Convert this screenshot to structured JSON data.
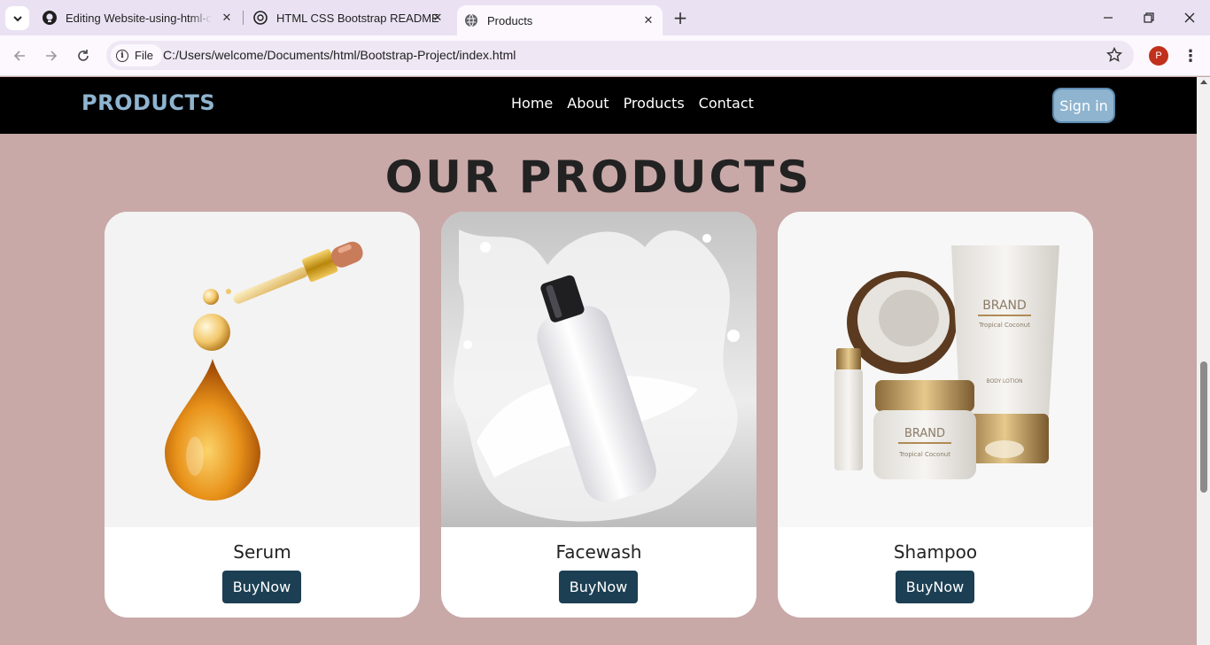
{
  "browser": {
    "tabs": [
      {
        "title": "Editing Website-using-html-css",
        "icon": "github-icon"
      },
      {
        "title": "HTML CSS Bootstrap README",
        "icon": "chatgpt-icon"
      },
      {
        "title": "Products",
        "icon": "globe-icon",
        "active": true
      }
    ],
    "address_chip": "File",
    "url": "C:/Users/welcome/Documents/html/Bootstrap-Project/index.html",
    "profile_initial": "P"
  },
  "site": {
    "brand": "PRODUCTS",
    "nav": [
      "Home",
      "About",
      "Products",
      "Contact"
    ],
    "signin_label": "Sign in",
    "heading": "OUR PRODUCTS",
    "products": [
      {
        "name": "Serum",
        "button": "BuyNow",
        "image": "serum-dropper-image"
      },
      {
        "name": "Facewash",
        "button": "BuyNow",
        "image": "facewash-milk-splash-image"
      },
      {
        "name": "Shampoo",
        "button": "BuyNow",
        "image": "coconut-cosmetics-image",
        "image_text": {
          "brand": "BRAND",
          "sub": "Tropical Coconut",
          "lotion": "BODY LOTION"
        }
      }
    ]
  },
  "colors": {
    "page_bg": "#c9a8a8",
    "nav_bg": "#000000",
    "brand": "#8fb4cf",
    "button": "#1c3f53"
  }
}
